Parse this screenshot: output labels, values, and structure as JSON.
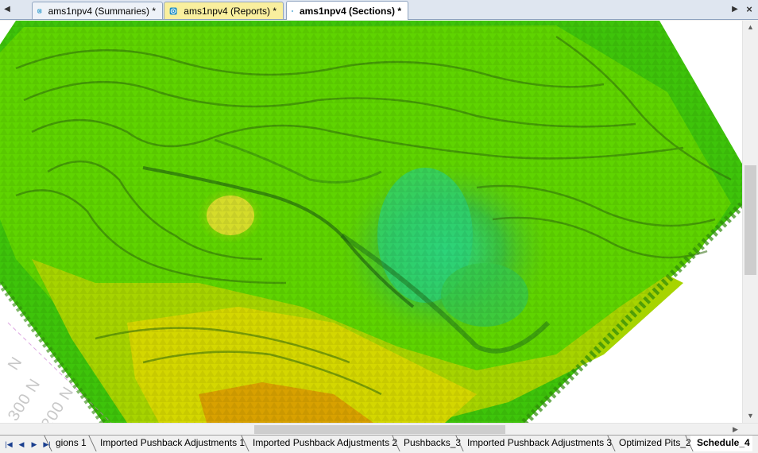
{
  "window": {
    "tabs": [
      {
        "label": "ams1npv4 (Summaries) *",
        "icon": "pit-document-icon"
      },
      {
        "label": "ams1npv4 (Reports) *",
        "icon": "pit-document-icon"
      },
      {
        "label": "ams1npv4 (Sections) *",
        "icon": "pit-document-icon",
        "active": true
      }
    ],
    "nav_left": "◀",
    "nav_right": "▶",
    "close": "×"
  },
  "viewport": {
    "grid_labels": [
      "N",
      "300 N",
      "200 N"
    ],
    "colors": {
      "bright_green": "#3ec40a",
      "mid_green": "#5fd400",
      "yellow_green": "#a7d400",
      "yellow": "#d7d900",
      "orange": "#d8a100",
      "pit_green": "#24d06a"
    }
  },
  "scrollbars": {
    "up": "▲",
    "down": "▼",
    "right": "▶"
  },
  "sheet_tabs": {
    "nav": [
      "|◀",
      "◀",
      "▶",
      "▶|"
    ],
    "items": [
      {
        "label": "gions 1"
      },
      {
        "label": "Imported Pushback Adjustments 1"
      },
      {
        "label": "Imported Pushback Adjustments 2"
      },
      {
        "label": "Pushbacks_3"
      },
      {
        "label": "Imported Pushback Adjustments 3"
      },
      {
        "label": "Optimized Pits_2"
      },
      {
        "label": "Schedule_4",
        "active": true
      }
    ]
  }
}
